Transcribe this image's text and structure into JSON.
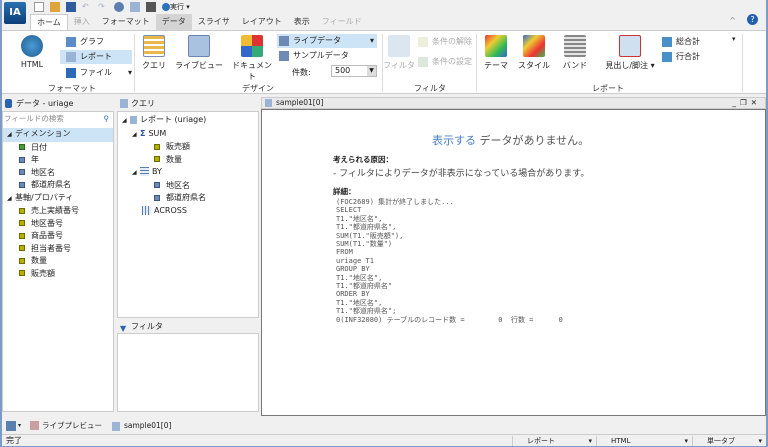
{
  "app": {
    "logo": "IA",
    "run_label": "実行"
  },
  "tabs": [
    {
      "label": "ホーム"
    },
    {
      "label": "挿入"
    },
    {
      "label": "フォーマット"
    },
    {
      "label": "データ"
    },
    {
      "label": "スライサ"
    },
    {
      "label": "レイアウト"
    },
    {
      "label": "表示"
    },
    {
      "label": "フィールド"
    }
  ],
  "ribbon": {
    "format": {
      "html": "HTML",
      "graph": "グラフ",
      "report": "レポート",
      "file": "ファイル",
      "label": "フォーマット"
    },
    "design": {
      "query": "クエリ",
      "liveview": "ライブビュー",
      "document": "ドキュメント",
      "livedata": "ライブデータ",
      "sampledata": "サンプルデータ",
      "count_label": "件数:",
      "count_value": "500",
      "label": "デザイン"
    },
    "filter": {
      "filter": "フィルタ",
      "clear": "条件の解除",
      "set": "条件の設定",
      "label": "フィルタ"
    },
    "report": {
      "theme": "テーマ",
      "style": "スタイル",
      "band": "バンド",
      "header_footer": "見出し/脚注",
      "grand_total": "総合計",
      "row_total": "行合計",
      "label": "レポート"
    }
  },
  "data_panel": {
    "title": "データ - uriage",
    "search_placeholder": "フィールドの検索",
    "groups": [
      {
        "label": "ディメンション",
        "items": [
          "日付",
          "年",
          "地区名",
          "都道府県名"
        ]
      },
      {
        "label": "基軸/プロパティ",
        "items": [
          "売上実績番号",
          "地区番号",
          "商品番号",
          "担当者番号",
          "数量",
          "販売額"
        ]
      }
    ]
  },
  "query_panel": {
    "title": "クエリ",
    "root": "レポート (uriage)",
    "sum": "SUM",
    "sum_items": [
      "販売額",
      "数量"
    ],
    "by": "BY",
    "by_items": [
      "地区名",
      "都道府県名"
    ],
    "across": "ACROSS"
  },
  "filter_panel": {
    "title": "フィルタ"
  },
  "document": {
    "title": "sample01[0]",
    "headline_accent": "表示する",
    "headline_rest": " データがありません。",
    "reason_label": "考えられる原因：",
    "reason": "- フィルタによりデータが非表示になっている場合があります。",
    "details_label": "詳細：",
    "details": "(FOC2689) 集計が終了しました...\nSELECT\nT1.\"地区名\",\nT1.\"都道府県名\",\nSUM(T1.\"販売額\"),\nSUM(T1.\"数量\")\nFROM\nuriage T1\nGROUP BY\nT1.\"地区名\",\nT1.\"都道府県名\"\nORDER BY\nT1.\"地区名\",\nT1.\"都道府県名\";\n0(INF32080) テーブルのレコード数 =        0  行数 =      0"
  },
  "bottom_tabs": [
    {
      "label": "ライブプレビュー"
    },
    {
      "label": "sample01[0]"
    }
  ],
  "status": {
    "text": "完了",
    "report": "レポート",
    "html": "HTML",
    "single_tab": "単一タブ"
  }
}
